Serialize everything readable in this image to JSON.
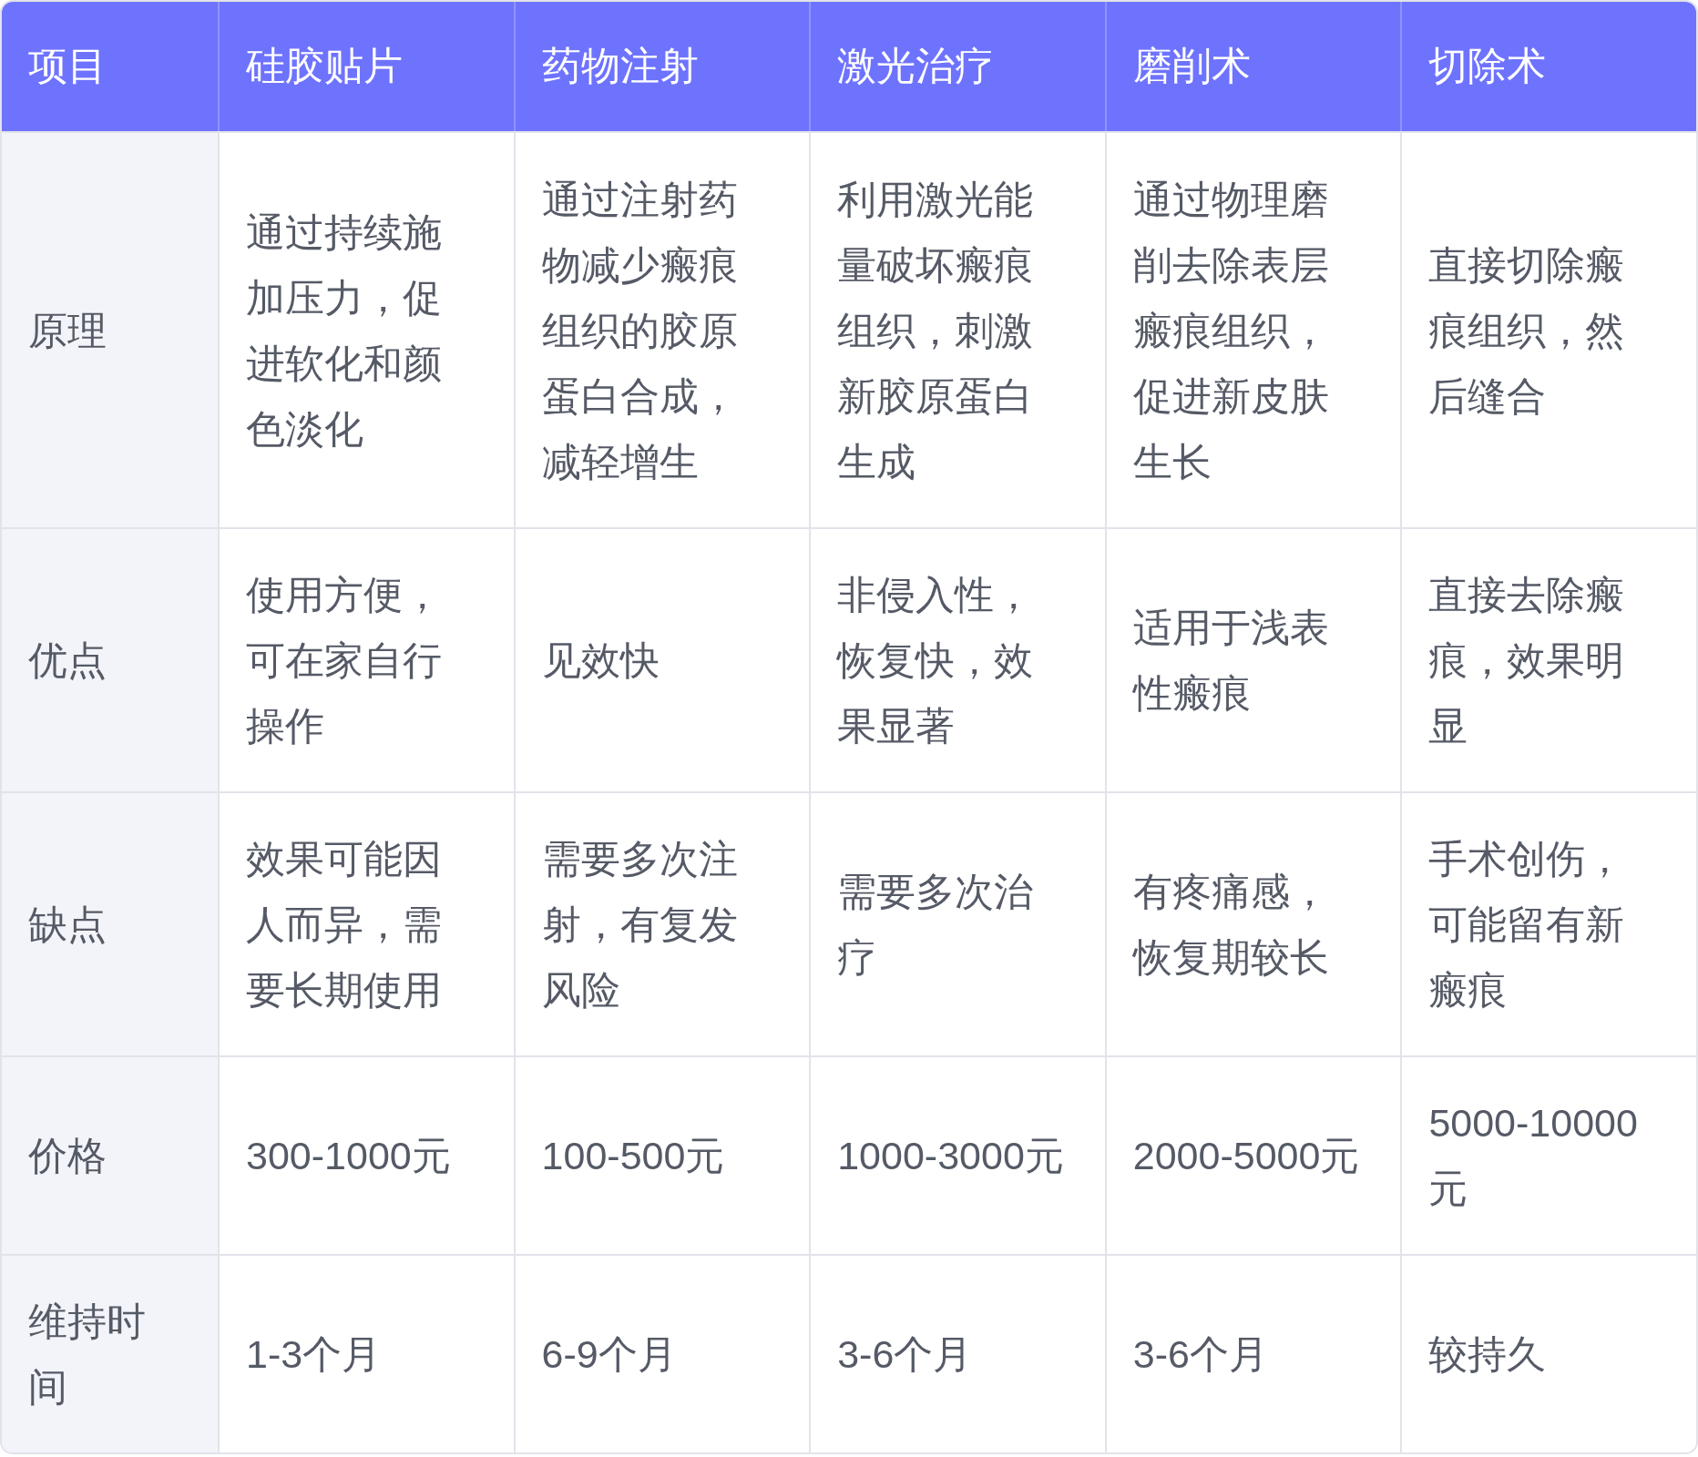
{
  "table": {
    "columns": [
      "项目",
      "硅胶贴片",
      "药物注射",
      "激光治疗",
      "磨削术",
      "切除术"
    ],
    "rows": [
      {
        "cells": [
          "原理",
          "通过持续施加压力，促进软化和颜色淡化",
          "通过注射药物减少瘢痕组织的胶原蛋白合成，减轻增生",
          "利用激光能量破坏瘢痕组织，刺激新胶原蛋白生成",
          "通过物理磨削去除表层瘢痕组织，促进新皮肤生长",
          "直接切除瘢痕组织，然后缝合"
        ]
      },
      {
        "cells": [
          "优点",
          "使用方便，可在家自行操作",
          "见效快",
          "非侵入性，恢复快，效果显著",
          "适用于浅表性瘢痕",
          "直接去除瘢痕，效果明显"
        ]
      },
      {
        "cells": [
          "缺点",
          "效果可能因人而异，需要长期使用",
          "需要多次注射，有复发风险",
          "需要多次治疗",
          "有疼痛感，恢复期较长",
          "手术创伤，可能留有新瘢痕"
        ]
      },
      {
        "cells": [
          "价格",
          "300-1000元",
          "100-500元",
          "1000-3000元",
          "2000-5000元",
          "5000-10000元"
        ]
      },
      {
        "cells": [
          "维持时间",
          "1-3个月",
          "6-9个月",
          "3-6个月",
          "3-6个月",
          "较持久"
        ]
      }
    ]
  }
}
